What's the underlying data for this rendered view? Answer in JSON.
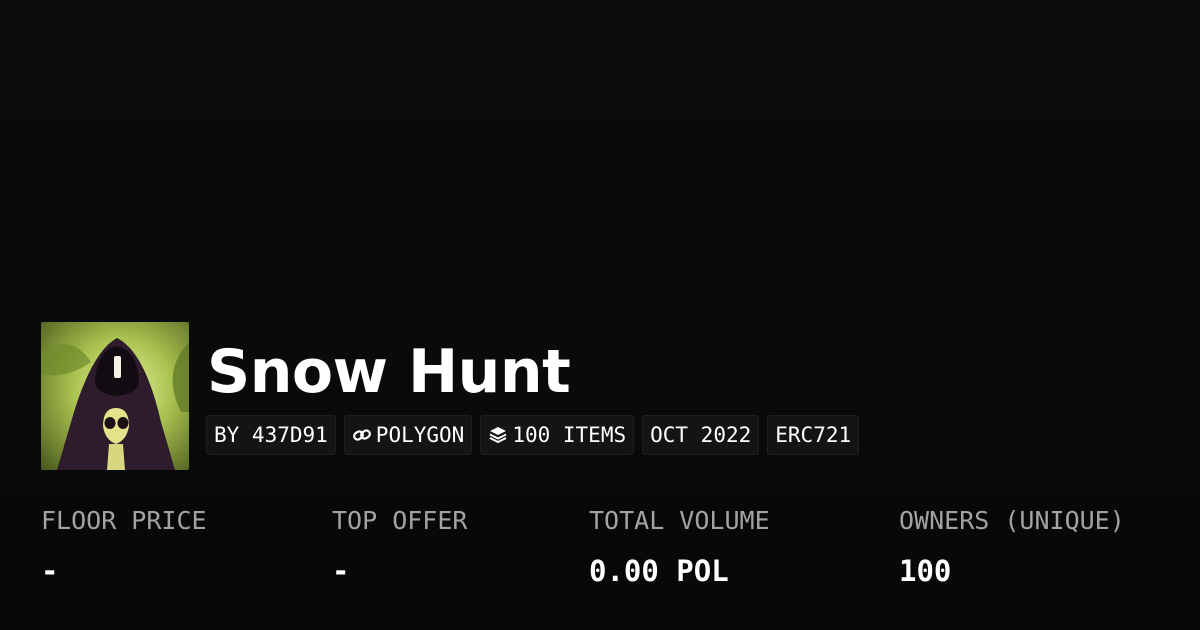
{
  "collection": {
    "name": "Snow Hunt",
    "avatar_icon": "hooded-figure-avatar"
  },
  "tags": [
    {
      "label": "BY 437D91",
      "icon": null
    },
    {
      "label": "POLYGON",
      "icon": "chain-link-icon"
    },
    {
      "label": "100 ITEMS",
      "icon": "layers-icon"
    },
    {
      "label": "OCT 2022",
      "icon": null
    },
    {
      "label": "ERC721",
      "icon": null
    }
  ],
  "stats": [
    {
      "label": "FLOOR PRICE",
      "value": "-"
    },
    {
      "label": "TOP OFFER",
      "value": "-"
    },
    {
      "label": "TOTAL VOLUME",
      "value": "0.00 POL"
    },
    {
      "label": "OWNERS (UNIQUE)",
      "value": "100"
    }
  ],
  "colors": {
    "background": "#0a0a0b",
    "tag_background": "#141415",
    "label_gray": "#a3a3a3",
    "text_white": "#ffffff"
  }
}
